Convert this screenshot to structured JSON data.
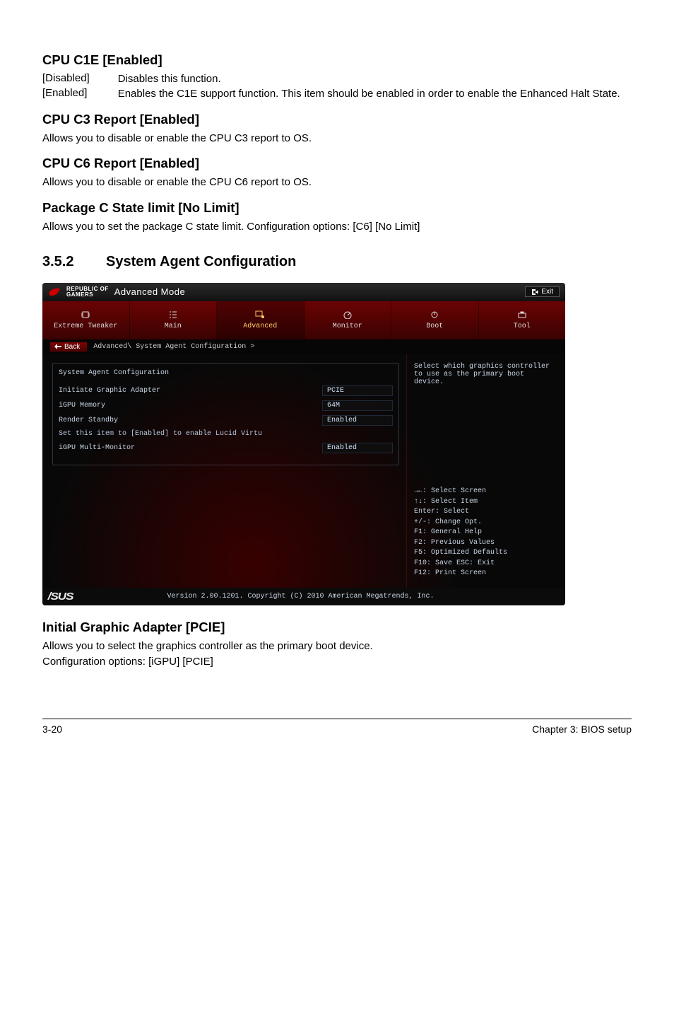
{
  "sections": {
    "c1e": {
      "heading": "CPU C1E [Enabled]",
      "opts": [
        {
          "key": "[Disabled]",
          "val": "Disables this function."
        },
        {
          "key": "[Enabled]",
          "val": "Enables the C1E support function. This item should be enabled in order to enable the Enhanced Halt State."
        }
      ]
    },
    "c3": {
      "heading": "CPU C3 Report [Enabled]",
      "desc": "Allows you to disable or enable the CPU C3 report to OS."
    },
    "c6": {
      "heading": "CPU C6 Report [Enabled]",
      "desc": "Allows you to disable or enable the CPU C6 report to OS."
    },
    "pkg": {
      "heading": "Package C State limit [No Limit]",
      "desc": "Allows you to set the package C state limit. Configuration options: [C6] [No Limit]"
    },
    "h2_num": "3.5.2",
    "h2_title": "System Agent Configuration",
    "iga": {
      "heading": "Initial Graphic Adapter [PCIE]",
      "desc1": "Allows you to select the graphics controller as the primary boot device.",
      "desc2": "Configuration options: [iGPU] [PCIE]"
    }
  },
  "bios": {
    "brand_l1": "REPUBLIC OF",
    "brand_l2": "GAMERS",
    "mode": "Advanced Mode",
    "exit": "Exit",
    "tabs": {
      "extreme": "Extreme Tweaker",
      "main": "Main",
      "advanced": "Advanced",
      "monitor": "Monitor",
      "boot": "Boot",
      "tool": "Tool"
    },
    "back": "Back",
    "breadcrumb": "Advanced\\ System Agent Configuration >",
    "group_title": "System Agent Configuration",
    "rows": {
      "iga": {
        "label": "Initiate Graphic Adapter",
        "val": "PCIE"
      },
      "igpu_mem": {
        "label": "iGPU Memory",
        "val": "64M"
      },
      "render": {
        "label": "Render Standby",
        "val": "Enabled"
      },
      "mm_hint": "Set this item to [Enabled] to enable Lucid Virtu",
      "mm": {
        "label": "iGPU Multi-Monitor",
        "val": "Enabled"
      }
    },
    "help_text": "Select which graphics controller to use as the primary boot device.",
    "keys": {
      "k1": "→←: Select Screen",
      "k2": "↑↓: Select Item",
      "k3": "Enter: Select",
      "k4": "+/-: Change Opt.",
      "k5": "F1: General Help",
      "k6": "F2: Previous Values",
      "k7": "F5: Optimized Defaults",
      "k8": "F10: Save  ESC: Exit",
      "k9": "F12: Print Screen"
    },
    "footer_logo": "/SUS",
    "footer_text": "Version 2.00.1201. Copyright (C) 2010 American Megatrends, Inc."
  },
  "page_footer": {
    "left": "3-20",
    "right": "Chapter 3: BIOS setup"
  }
}
